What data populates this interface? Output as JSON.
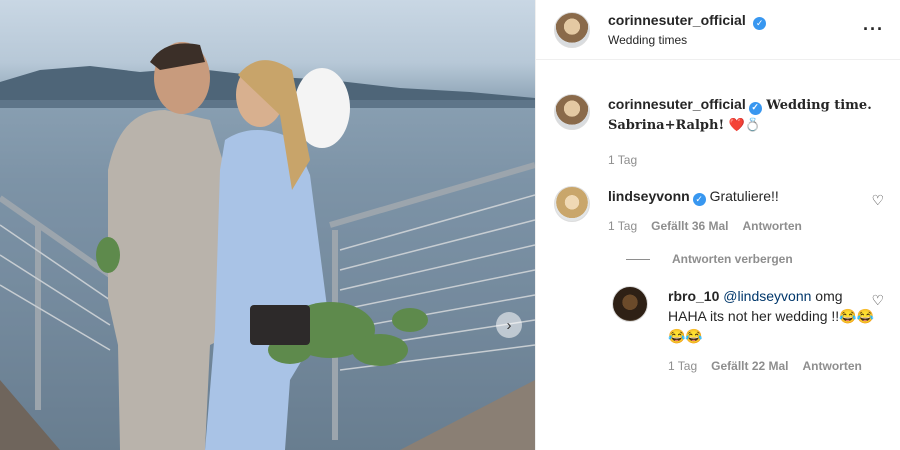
{
  "header": {
    "username": "corinnesuter_official",
    "location": "Wedding times",
    "more_icon": "more-horizontal-icon"
  },
  "caption": {
    "username": "corinnesuter_official",
    "text_bold": "Wedding time.",
    "text_line2": "Sabrina+Ralph!",
    "emojis": "❤️💍",
    "time": "1 Tag"
  },
  "comments": [
    {
      "username": "lindseyvonn",
      "text": "Gratuliere!!",
      "time": "1 Tag",
      "likes": "Gefällt 36 Mal",
      "reply": "Antworten"
    }
  ],
  "hide_replies": "Antworten verbergen",
  "reply": {
    "username": "rbro_10",
    "mention": "@lindseyvonn",
    "text": "omg HAHA its not her wedding !!😂😂😂😂",
    "time": "1 Tag",
    "likes": "Gefällt 22 Mal",
    "reply": "Antworten"
  },
  "colors": {
    "verified": "#3897f0",
    "meta": "#8e8e8e",
    "mention": "#00376b"
  }
}
